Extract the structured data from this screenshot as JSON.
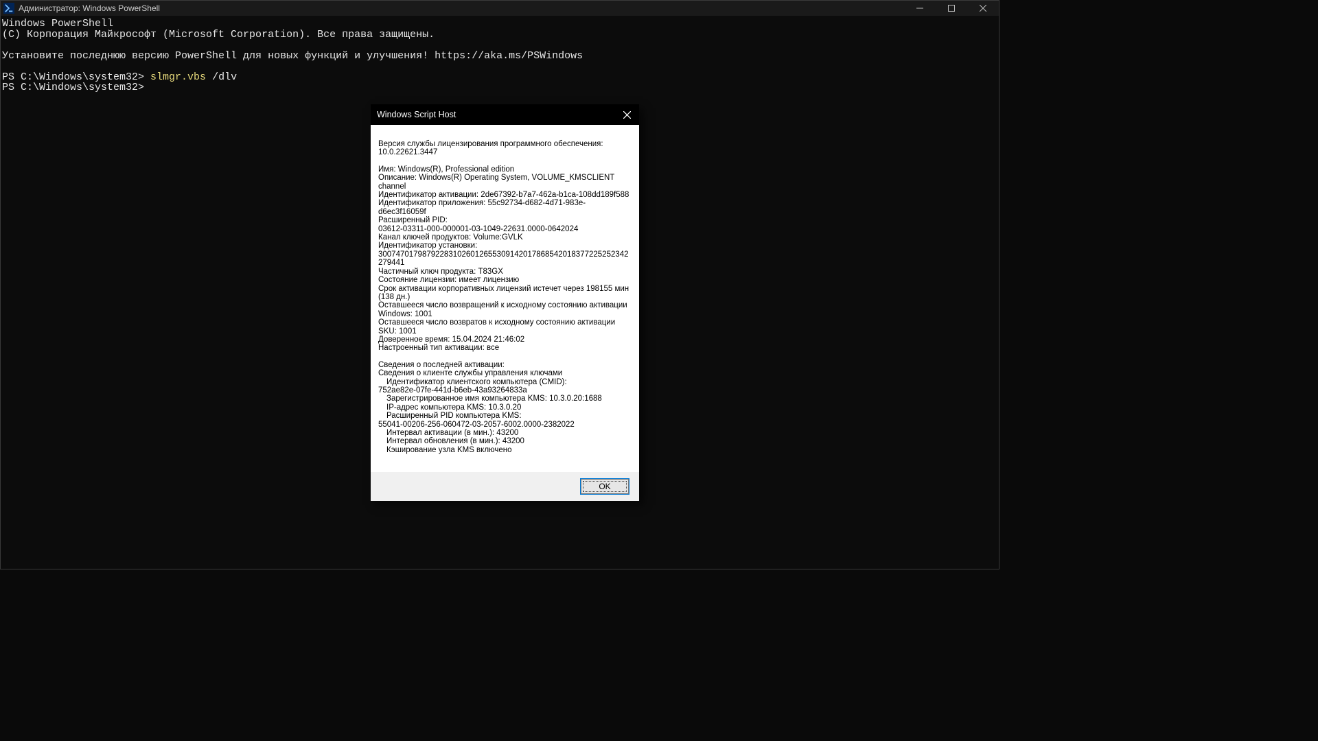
{
  "terminal": {
    "title": "Администратор: Windows PowerShell",
    "lines": {
      "l1": "Windows PowerShell",
      "l2": "(C) Корпорация Майкрософт (Microsoft Corporation). Все права защищены.",
      "l3": "",
      "l4": "Установите последнюю версию PowerShell для новых функций и улучшения! https://aka.ms/PSWindows",
      "l5": "",
      "prompt1_prefix": "PS C:\\Windows\\system32> ",
      "prompt1_cmd": "slmgr.vbs",
      "prompt1_arg": " /dlv",
      "prompt2": "PS C:\\Windows\\system32>"
    }
  },
  "dialog": {
    "title": "Windows Script Host",
    "ok_label": "OK",
    "body": {
      "ver_label": "Версия службы лицензирования программного обеспечения: 10.0.22621.3447",
      "name": "Имя: Windows(R), Professional edition",
      "desc": "Описание: Windows(R) Operating System, VOLUME_KMSCLIENT channel",
      "act_id": "Идентификатор активации: 2de67392-b7a7-462a-b1ca-108dd189f588",
      "app_id": "Идентификатор приложения: 55c92734-d682-4d71-983e-d6ec3f16059f",
      "ext_pid_label": "Расширенный PID:",
      "ext_pid_val": "03612-03311-000-000001-03-1049-22631.0000-0642024",
      "key_channel": "Канал ключей продуктов: Volume:GVLK",
      "inst_id_label": "Идентификатор установки:",
      "inst_id_val": "300747017987922831026012655309142017868542018377225252342279441",
      "partial_key": "Частичный ключ продукта: T83GX",
      "lic_state": "Состояние лицензии: имеет лицензию",
      "expiry": "Срок активации корпоративных лицензий истечет через 198155 мин (138 дн.)",
      "rearm_win": "Оставшееся число возвращений к исходному состоянию активации Windows: 1001",
      "rearm_sku": "Оставшееся число возвратов к исходному состоянию активации SKU: 1001",
      "trusted_time": "Доверенное время: 15.04.2024 21:46:02",
      "act_type": "Настроенный тип активации: все",
      "last_act_header": "Сведения о последней активации:",
      "kms_client": "Сведения о клиенте службы управления ключами",
      "cmid_label": "Идентификатор клиентского компьютера (CMID):",
      "cmid_val": "752ae82e-07fe-441d-b6eb-43a93264833a",
      "kms_name": "Зарегистрированное имя компьютера KMS: 10.3.0.20:1688",
      "kms_ip": "IP-адрес компьютера KMS: 10.3.0.20",
      "kms_pid_label": "Расширенный PID компьютера KMS:",
      "kms_pid_val": "55041-00206-256-060472-03-2057-6002.0000-2382022",
      "act_interval": "Интервал активации (в мин.): 43200",
      "renew_interval": "Интервал обновления (в мин.): 43200",
      "kms_cache": "Кэширование узла KMS включено"
    }
  }
}
